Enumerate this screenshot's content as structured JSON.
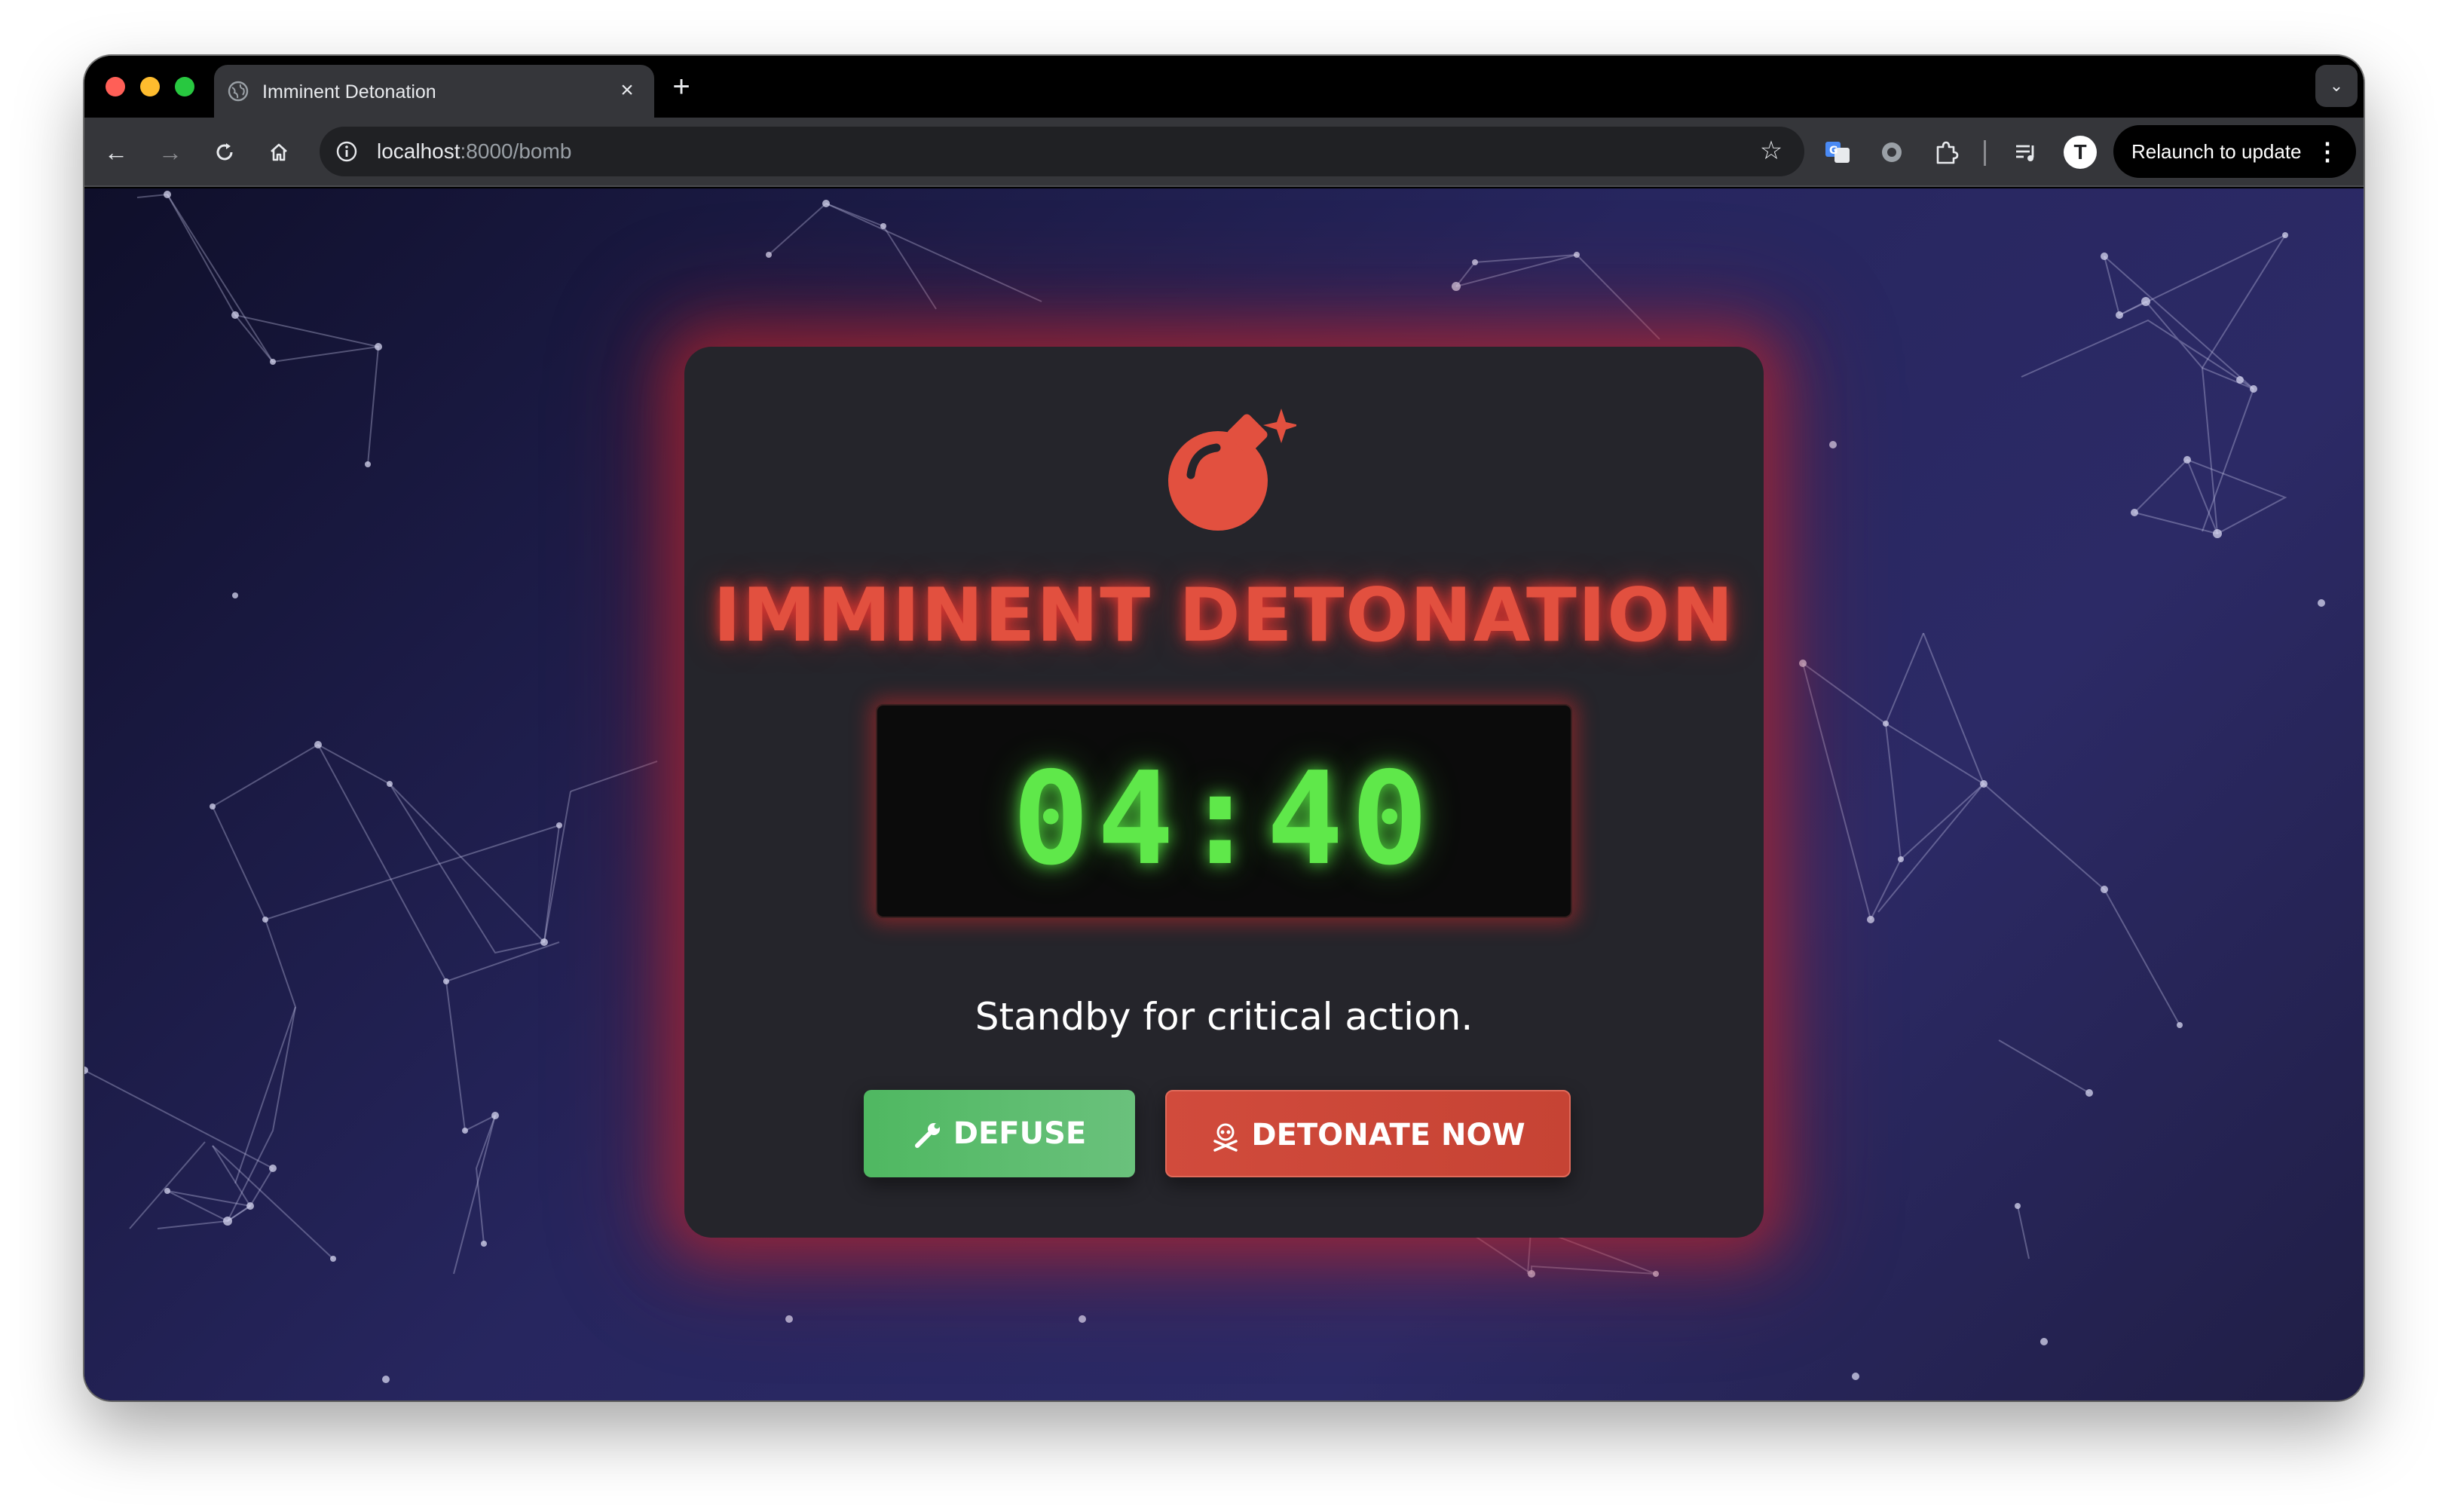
{
  "browser": {
    "tab_title": "Imminent Detonation",
    "url_host": "localhost",
    "url_rest": ":8000/bomb",
    "relaunch_label": "Relaunch to update",
    "profile_initial": "T"
  },
  "page": {
    "title": "IMMINENT DETONATION",
    "timer": "04:40",
    "status": "Standby for critical action.",
    "defuse_label": "DEFUSE",
    "detonate_label": "DETONATE NOW"
  },
  "colors": {
    "title_red": "#e2503f",
    "timer_green": "#5fe84a",
    "defuse_green": "#4fb861",
    "detonate_red": "#d14b3c",
    "card_bg": "#25252b"
  },
  "icons": {
    "bomb": "bomb-icon",
    "defuse": "wrench-icon",
    "detonate": "skull-crossbones-icon"
  }
}
